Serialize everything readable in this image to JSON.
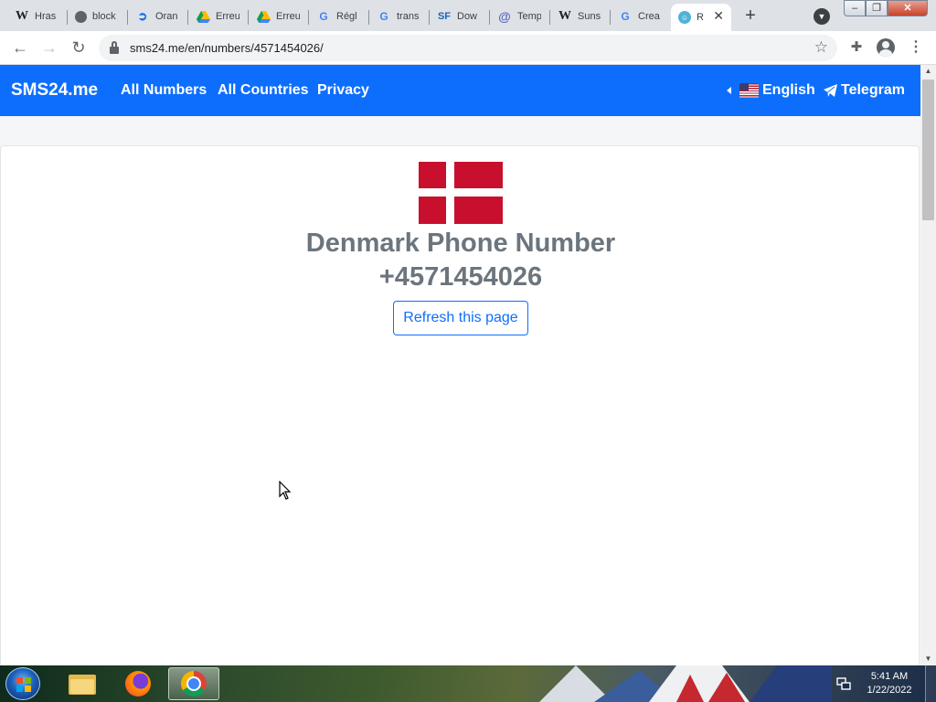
{
  "browser": {
    "tabs": [
      {
        "label": "Hras",
        "icon": "wikipedia-icon"
      },
      {
        "label": "block",
        "icon": "globe-icon"
      },
      {
        "label": "Oran",
        "icon": "swirl-icon"
      },
      {
        "label": "Erreu",
        "icon": "google-drive-icon"
      },
      {
        "label": "Erreu",
        "icon": "google-drive-icon"
      },
      {
        "label": "Régl",
        "icon": "google-icon"
      },
      {
        "label": "trans",
        "icon": "google-icon"
      },
      {
        "label": "Dow",
        "icon": "sourceforge-icon"
      },
      {
        "label": "Temp",
        "icon": "at-sign-icon"
      },
      {
        "label": "Suns",
        "icon": "wikipedia-icon"
      },
      {
        "label": "Crea",
        "icon": "google-icon"
      },
      {
        "label": "R",
        "icon": "chat-bubble-icon",
        "active": true
      }
    ],
    "url": "sms24.me/en/numbers/4571454026/",
    "colors": {
      "tabstrip": "#dee1e6",
      "toolbar": "#ffffff"
    }
  },
  "page": {
    "navbar": {
      "brand": "SMS24.me",
      "links": [
        "All Numbers",
        "All Countries",
        "Privacy"
      ],
      "language": "English",
      "telegram": "Telegram",
      "color": "#0d6efd"
    },
    "country_flag": "denmark-flag",
    "title_line1": "Denmark Phone Number",
    "title_line2": "+4571454026",
    "refresh_label": "Refresh this page"
  },
  "taskbar": {
    "apps": [
      "windows-explorer",
      "firefox",
      "chrome"
    ],
    "active_app": "chrome",
    "clock_time": "5:41 AM",
    "clock_date": "1/22/2022"
  }
}
